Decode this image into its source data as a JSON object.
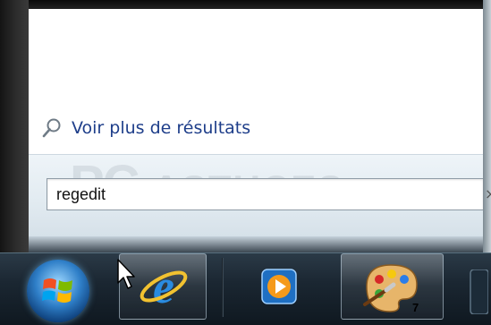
{
  "start_menu": {
    "see_more_results": "Voir plus de résultats",
    "search_value": "regedit",
    "clear_glyph": "×"
  },
  "watermark": {
    "line1": "PC",
    "line2": "ASTUCES"
  },
  "taskbar": {
    "buttons": [
      {
        "name": "start-orb",
        "icon": "windows-logo"
      },
      {
        "name": "internet-explorer",
        "icon": "ie-icon",
        "active": true
      },
      {
        "name": "media-player",
        "icon": "media-player-icon",
        "active": false
      },
      {
        "name": "paint",
        "icon": "paint-palette-icon",
        "active": true,
        "badge": "7"
      }
    ]
  }
}
